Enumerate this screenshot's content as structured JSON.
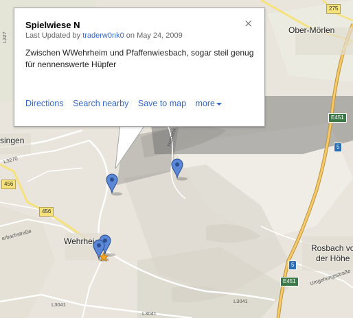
{
  "map": {
    "places": {
      "ober_morlen": "Ober-Mörlen",
      "singen": "singen",
      "wehrheim": "Wehrhei",
      "rosbach": "Rosbach vo",
      "der_hohe": "der Höhe"
    },
    "road_labels": {
      "l3270": "L3270",
      "bachstrasse": "erbachstraße",
      "umgehungsstrasse": "Umgehungsstraße",
      "l3041_a": "L3041",
      "l3041_b": "L3041",
      "l3041_c": "L3041",
      "hainerweg": "Hainerw",
      "left_fragment": "L327"
    },
    "shields": {
      "s275": "275",
      "s456a": "456",
      "s456b": "456",
      "a5_top": "5",
      "a5_bottom": "5",
      "e451_top": "E451",
      "e451_bottom": "E451"
    },
    "colors": {
      "land": "#e9e5dc",
      "forest": "#cfdfb4",
      "road_yellow": "#f6e27a",
      "motorway": "#f8c86a",
      "marker_blue": "#5a87d6",
      "link": "#3366cc"
    }
  },
  "infowindow": {
    "title": "Spielwiese N",
    "close_icon": "×",
    "meta_prefix": "Last Updated by",
    "author": "traderw0nk0",
    "meta_suffix": "on May 24, 2009",
    "description": "Zwischen WWehrheim und Pfaffenwiesbach, sogar steil genug für nennenswerte Hüpfer",
    "actions": {
      "directions": "Directions",
      "search_nearby": "Search nearby",
      "save_to_map": "Save to map",
      "more": "more"
    }
  },
  "markers": [
    {
      "name": "selected-placemark",
      "icon": "blue-map-pin"
    },
    {
      "name": "placemark-east",
      "icon": "blue-map-pin"
    },
    {
      "name": "placemark-wehrheim-1",
      "icon": "blue-map-pin"
    },
    {
      "name": "placemark-wehrheim-2",
      "icon": "blue-map-pin"
    },
    {
      "name": "star-marker",
      "icon": "orange-star"
    }
  ]
}
